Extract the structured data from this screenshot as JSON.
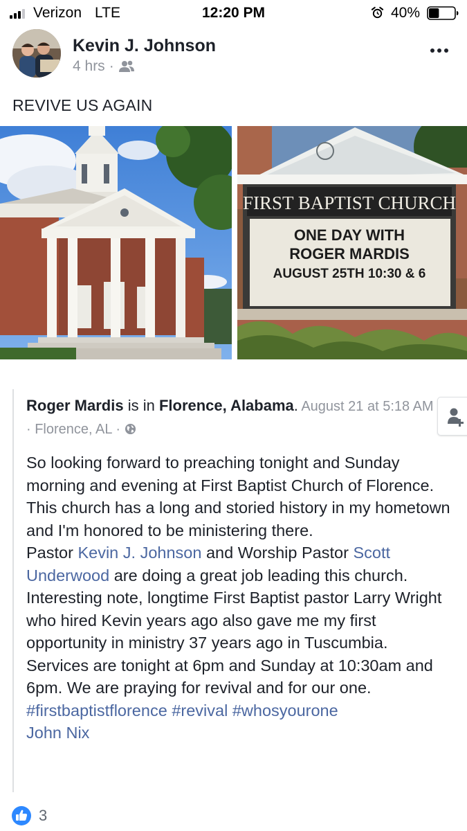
{
  "status_bar": {
    "carrier": "Verizon",
    "network": "LTE",
    "time": "12:20 PM",
    "battery": "40%",
    "signal_bars_active": 3,
    "battery_level": 0.4
  },
  "post": {
    "author": "Kevin J. Johnson",
    "time_ago": "4 hrs",
    "separator": "·",
    "audience_icon": "friends-icon",
    "text": "REVIVE US AGAIN",
    "photos": [
      {
        "icon": "church-building-photo"
      },
      {
        "icon": "church-sign-photo",
        "sign_title": "FIRST BAPTIST CHURCH",
        "sign_lines": [
          "ONE DAY WITH",
          "ROGER MARDIS",
          "AUGUST 25TH  10:30 & 6"
        ]
      }
    ]
  },
  "shared": {
    "author": "Roger Mardis",
    "is_in": " is in ",
    "place": "Florence, Alabama",
    "period": ".",
    "date": " August 21 at 5:18 AM · Florence, AL · ",
    "paragraph1": "So looking forward to preaching tonight and Sunday morning and evening at First Baptist Church of Florence. This church has a long and storied history in my hometown and I'm honored to be ministering there.",
    "p2_pre": "Pastor ",
    "p2_link1": "Kevin J. Johnson",
    "p2_mid": " and Worship Pastor ",
    "p2_link2": "Scott Underwood",
    "p2_post": " are doing a great job leading this church. Interesting note, longtime First Baptist pastor Larry Wright who hired Kevin years ago also gave me my first opportunity in ministry 37 years ago in Tuscumbia.",
    "p3_text": "Services are tonight at 6pm and Sunday at 10:30am and 6pm. We are praying for revival and for our one. ",
    "hashtags": [
      "#firstbaptistflorence",
      "#revival",
      "#whosyourone"
    ],
    "mention": "John Nix"
  },
  "reactions": {
    "icon": "like-icon",
    "count": "3"
  }
}
